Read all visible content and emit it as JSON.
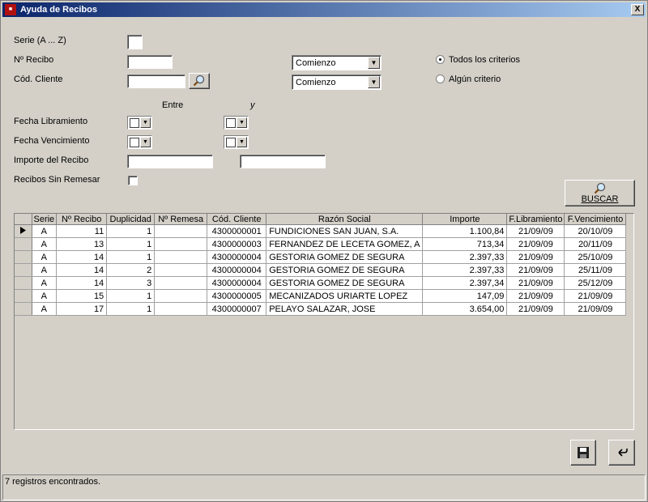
{
  "window": {
    "title": "Ayuda de Recibos",
    "close_label": "X"
  },
  "form": {
    "serie_label": "Serie (A ... Z)",
    "serie_value": "",
    "recibo_label": "Nº Recibo",
    "recibo_value": "",
    "recibo_match": "Comienzo",
    "cliente_label": "Cód. Cliente",
    "cliente_value": "",
    "cliente_match": "Comienzo",
    "criteria_all_label": "Todos los criterios",
    "criteria_any_label": "Algún criterio",
    "criteria_selected": "all",
    "between_label": "Entre",
    "and_label": "y",
    "fecha_libramiento_label": "Fecha Libramiento",
    "fecha_vencimiento_label": "Fecha Vencimiento",
    "importe_label": "Importe del Recibo",
    "importe_from": "",
    "importe_to": "",
    "sin_remesar_label": "Recibos Sin Remesar",
    "sin_remesar_checked": false,
    "search_button": "BUSCAR"
  },
  "table": {
    "columns": [
      "Serie",
      "Nº Recibo",
      "Duplicidad",
      "Nº Remesa",
      "Cód. Cliente",
      "Razón Social",
      "Importe",
      "F.Libramiento",
      "F.Vencimiento"
    ],
    "rows": [
      [
        "A",
        "11",
        "1",
        "",
        "4300000001",
        "FUNDICIONES SAN JUAN, S.A.",
        "1.100,84",
        "21/09/09",
        "20/10/09"
      ],
      [
        "A",
        "13",
        "1",
        "",
        "4300000003",
        "FERNANDEZ DE LECETA GOMEZ, A",
        "713,34",
        "21/09/09",
        "20/11/09"
      ],
      [
        "A",
        "14",
        "1",
        "",
        "4300000004",
        "GESTORIA GOMEZ DE SEGURA",
        "2.397,33",
        "21/09/09",
        "25/10/09"
      ],
      [
        "A",
        "14",
        "2",
        "",
        "4300000004",
        "GESTORIA GOMEZ DE SEGURA",
        "2.397,33",
        "21/09/09",
        "25/11/09"
      ],
      [
        "A",
        "14",
        "3",
        "",
        "4300000004",
        "GESTORIA GOMEZ DE SEGURA",
        "2.397,34",
        "21/09/09",
        "25/12/09"
      ],
      [
        "A",
        "15",
        "1",
        "",
        "4300000005",
        "MECANIZADOS URIARTE LOPEZ",
        "147,09",
        "21/09/09",
        "21/09/09"
      ],
      [
        "A",
        "17",
        "1",
        "",
        "4300000007",
        "PELAYO SALAZAR, JOSE",
        "3.654,00",
        "21/09/09",
        "21/09/09"
      ]
    ]
  },
  "status": {
    "text": "7 registros encontrados."
  },
  "icons": {
    "app": "app-icon",
    "search": "magnifier-icon",
    "save": "floppy-disk-icon",
    "undo": "undo-icon"
  }
}
